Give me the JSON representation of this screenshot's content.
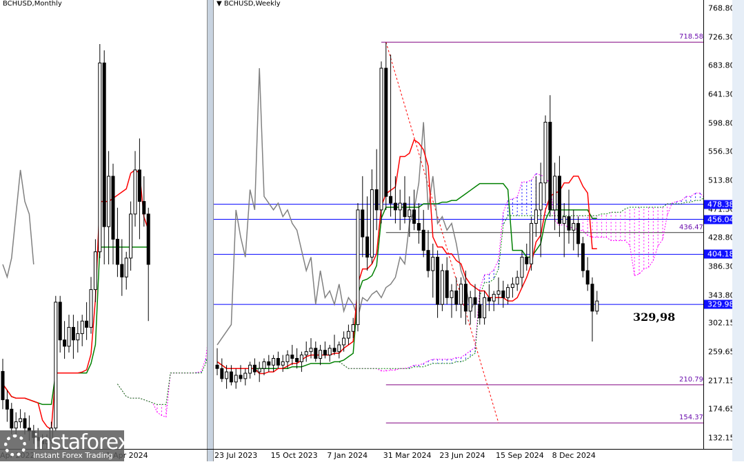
{
  "left_title": "BCHUSD,Monthly",
  "right_title": "BCHUSD,Weekly",
  "annotation": "329,98",
  "logo": {
    "name": "instaforex",
    "tagline": "Instant Forex Trading"
  },
  "colors": {
    "tenkan": "#ff0000",
    "kijun": "#008000",
    "chikou": "#808080",
    "cloud_up": "#0000ff",
    "cloud_down": "#ff00ff",
    "level": "#0000ff",
    "level_purple": "#800080"
  },
  "chart_data": [
    {
      "type": "candlestick",
      "title": "BCHUSD,Monthly",
      "ylim": [
        100,
        800
      ],
      "x_labels": [
        {
          "i": 0,
          "text": "Apr 2022"
        },
        {
          "i": 24,
          "text": "1 Apr 2024"
        }
      ],
      "ohlc": [
        [
          210,
          230,
          150,
          165
        ],
        [
          165,
          180,
          130,
          150
        ],
        [
          150,
          160,
          110,
          120
        ],
        [
          120,
          145,
          105,
          130
        ],
        [
          130,
          150,
          120,
          135
        ],
        [
          135,
          145,
          110,
          120
        ],
        [
          120,
          140,
          100,
          115
        ],
        [
          115,
          125,
          95,
          105
        ],
        [
          105,
          120,
          90,
          100
        ],
        [
          100,
          110,
          85,
          95
        ],
        [
          95,
          110,
          88,
          100
        ],
        [
          100,
          130,
          95,
          120
        ],
        [
          120,
          330,
          115,
          320
        ],
        [
          320,
          330,
          240,
          260
        ],
        [
          260,
          290,
          230,
          250
        ],
        [
          250,
          300,
          240,
          280
        ],
        [
          280,
          300,
          230,
          260
        ],
        [
          260,
          290,
          240,
          270
        ],
        [
          270,
          300,
          250,
          290
        ],
        [
          290,
          320,
          260,
          280
        ],
        [
          280,
          360,
          270,
          340
        ],
        [
          340,
          420,
          320,
          400
        ],
        [
          400,
          730,
          390,
          700
        ],
        [
          700,
          720,
          380,
          440
        ],
        [
          440,
          560,
          380,
          520
        ],
        [
          520,
          540,
          380,
          420
        ],
        [
          420,
          470,
          360,
          380
        ],
        [
          380,
          420,
          330,
          360
        ],
        [
          360,
          400,
          340,
          390
        ],
        [
          390,
          480,
          370,
          460
        ],
        [
          460,
          560,
          440,
          530
        ],
        [
          530,
          580,
          420,
          480
        ],
        [
          480,
          520,
          440,
          460
        ],
        [
          460,
          470,
          290,
          380
        ]
      ]
    },
    {
      "type": "candlestick",
      "title": "BCHUSD,Weekly",
      "ylim": [
        132.15,
        768.8
      ],
      "y_ticks": [
        "768.80",
        "726.30",
        "683.80",
        "641.30",
        "598.80",
        "556.30",
        "513.80",
        "471.30",
        "428.80",
        "386.30",
        "343.80",
        "302.15",
        "259.65",
        "217.15",
        "174.65",
        "132.15"
      ],
      "x_labels": [
        {
          "i": 0,
          "text": "23 Jul 2023"
        },
        {
          "i": 12,
          "text": "15 Oct 2023"
        },
        {
          "i": 24,
          "text": "7 Jan 2024"
        },
        {
          "i": 36,
          "text": "31 Mar 2024"
        },
        {
          "i": 48,
          "text": "23 Jun 2024"
        },
        {
          "i": 60,
          "text": "15 Sep 2024"
        },
        {
          "i": 72,
          "text": "8 Dec 2024"
        }
      ],
      "levels_blue": [
        {
          "value": 478.38,
          "label": "478.38"
        },
        {
          "value": 456.04,
          "label": "456.04"
        },
        {
          "value": 404.18,
          "label": "404.18"
        },
        {
          "value": 329.98,
          "label": "329.98"
        }
      ],
      "levels_purple": [
        {
          "value": 718.58,
          "label": "718.58",
          "from_i": 35
        },
        {
          "value": 436.47,
          "label": "436.47",
          "from_i": 36
        },
        {
          "value": 210.79,
          "label": "210.79",
          "from_i": 36
        },
        {
          "value": 154.37,
          "label": "154.37",
          "from_i": 36
        }
      ],
      "trend_line": {
        "from": {
          "i": 36,
          "value": 718.58
        },
        "to": {
          "i": 60,
          "value": 154.37
        }
      },
      "ohlc": [
        [
          240,
          265,
          225,
          235
        ],
        [
          235,
          250,
          215,
          220
        ],
        [
          220,
          240,
          205,
          230
        ],
        [
          230,
          240,
          210,
          215
        ],
        [
          215,
          235,
          205,
          225
        ],
        [
          225,
          240,
          215,
          220
        ],
        [
          220,
          235,
          210,
          228
        ],
        [
          228,
          245,
          220,
          240
        ],
        [
          240,
          250,
          225,
          230
        ],
        [
          230,
          245,
          215,
          235
        ],
        [
          235,
          250,
          225,
          245
        ],
        [
          245,
          255,
          230,
          240
        ],
        [
          240,
          255,
          230,
          250
        ],
        [
          250,
          260,
          235,
          240
        ],
        [
          240,
          255,
          230,
          245
        ],
        [
          245,
          262,
          235,
          255
        ],
        [
          255,
          270,
          240,
          250
        ],
        [
          250,
          265,
          235,
          245
        ],
        [
          245,
          260,
          230,
          255
        ],
        [
          255,
          275,
          245,
          260
        ],
        [
          260,
          280,
          250,
          265
        ],
        [
          265,
          275,
          245,
          250
        ],
        [
          250,
          270,
          240,
          262
        ],
        [
          262,
          275,
          250,
          255
        ],
        [
          255,
          270,
          245,
          265
        ],
        [
          265,
          285,
          255,
          260
        ],
        [
          260,
          275,
          250,
          270
        ],
        [
          270,
          290,
          260,
          280
        ],
        [
          280,
          300,
          270,
          290
        ],
        [
          290,
          310,
          280,
          300
        ],
        [
          300,
          480,
          290,
          470
        ],
        [
          470,
          520,
          400,
          430
        ],
        [
          430,
          490,
          380,
          400
        ],
        [
          400,
          530,
          390,
          500
        ],
        [
          500,
          560,
          440,
          470
        ],
        [
          470,
          690,
          450,
          680
        ],
        [
          680,
          718,
          470,
          490
        ],
        [
          490,
          700,
          460,
          480
        ],
        [
          480,
          520,
          450,
          470
        ],
        [
          470,
          500,
          440,
          480
        ],
        [
          480,
          520,
          450,
          460
        ],
        [
          460,
          490,
          430,
          470
        ],
        [
          470,
          500,
          440,
          450
        ],
        [
          450,
          480,
          420,
          440
        ],
        [
          440,
          470,
          400,
          410
        ],
        [
          410,
          440,
          370,
          380
        ],
        [
          380,
          420,
          340,
          400
        ],
        [
          400,
          410,
          310,
          330
        ],
        [
          330,
          390,
          320,
          380
        ],
        [
          380,
          400,
          330,
          340
        ],
        [
          340,
          360,
          310,
          350
        ],
        [
          350,
          370,
          320,
          330
        ],
        [
          330,
          370,
          310,
          360
        ],
        [
          360,
          380,
          300,
          320
        ],
        [
          320,
          350,
          300,
          340
        ],
        [
          340,
          360,
          310,
          330
        ],
        [
          330,
          350,
          300,
          310
        ],
        [
          310,
          350,
          300,
          340
        ],
        [
          340,
          360,
          320,
          335
        ],
        [
          335,
          350,
          320,
          345
        ],
        [
          345,
          370,
          330,
          350
        ],
        [
          350,
          365,
          325,
          340
        ],
        [
          340,
          360,
          330,
          355
        ],
        [
          355,
          370,
          340,
          360
        ],
        [
          360,
          380,
          350,
          370
        ],
        [
          370,
          410,
          355,
          400
        ],
        [
          400,
          420,
          380,
          390
        ],
        [
          390,
          460,
          380,
          450
        ],
        [
          450,
          520,
          430,
          470
        ],
        [
          470,
          540,
          400,
          510
        ],
        [
          510,
          610,
          480,
          600
        ],
        [
          600,
          640,
          460,
          470
        ],
        [
          470,
          540,
          440,
          520
        ],
        [
          520,
          550,
          430,
          450
        ],
        [
          450,
          480,
          400,
          460
        ],
        [
          460,
          500,
          420,
          440
        ],
        [
          440,
          470,
          410,
          450
        ],
        [
          450,
          460,
          400,
          420
        ],
        [
          420,
          430,
          370,
          380
        ],
        [
          380,
          400,
          350,
          360
        ],
        [
          360,
          370,
          275,
          320
        ],
        [
          320,
          350,
          315,
          335
        ]
      ]
    }
  ]
}
